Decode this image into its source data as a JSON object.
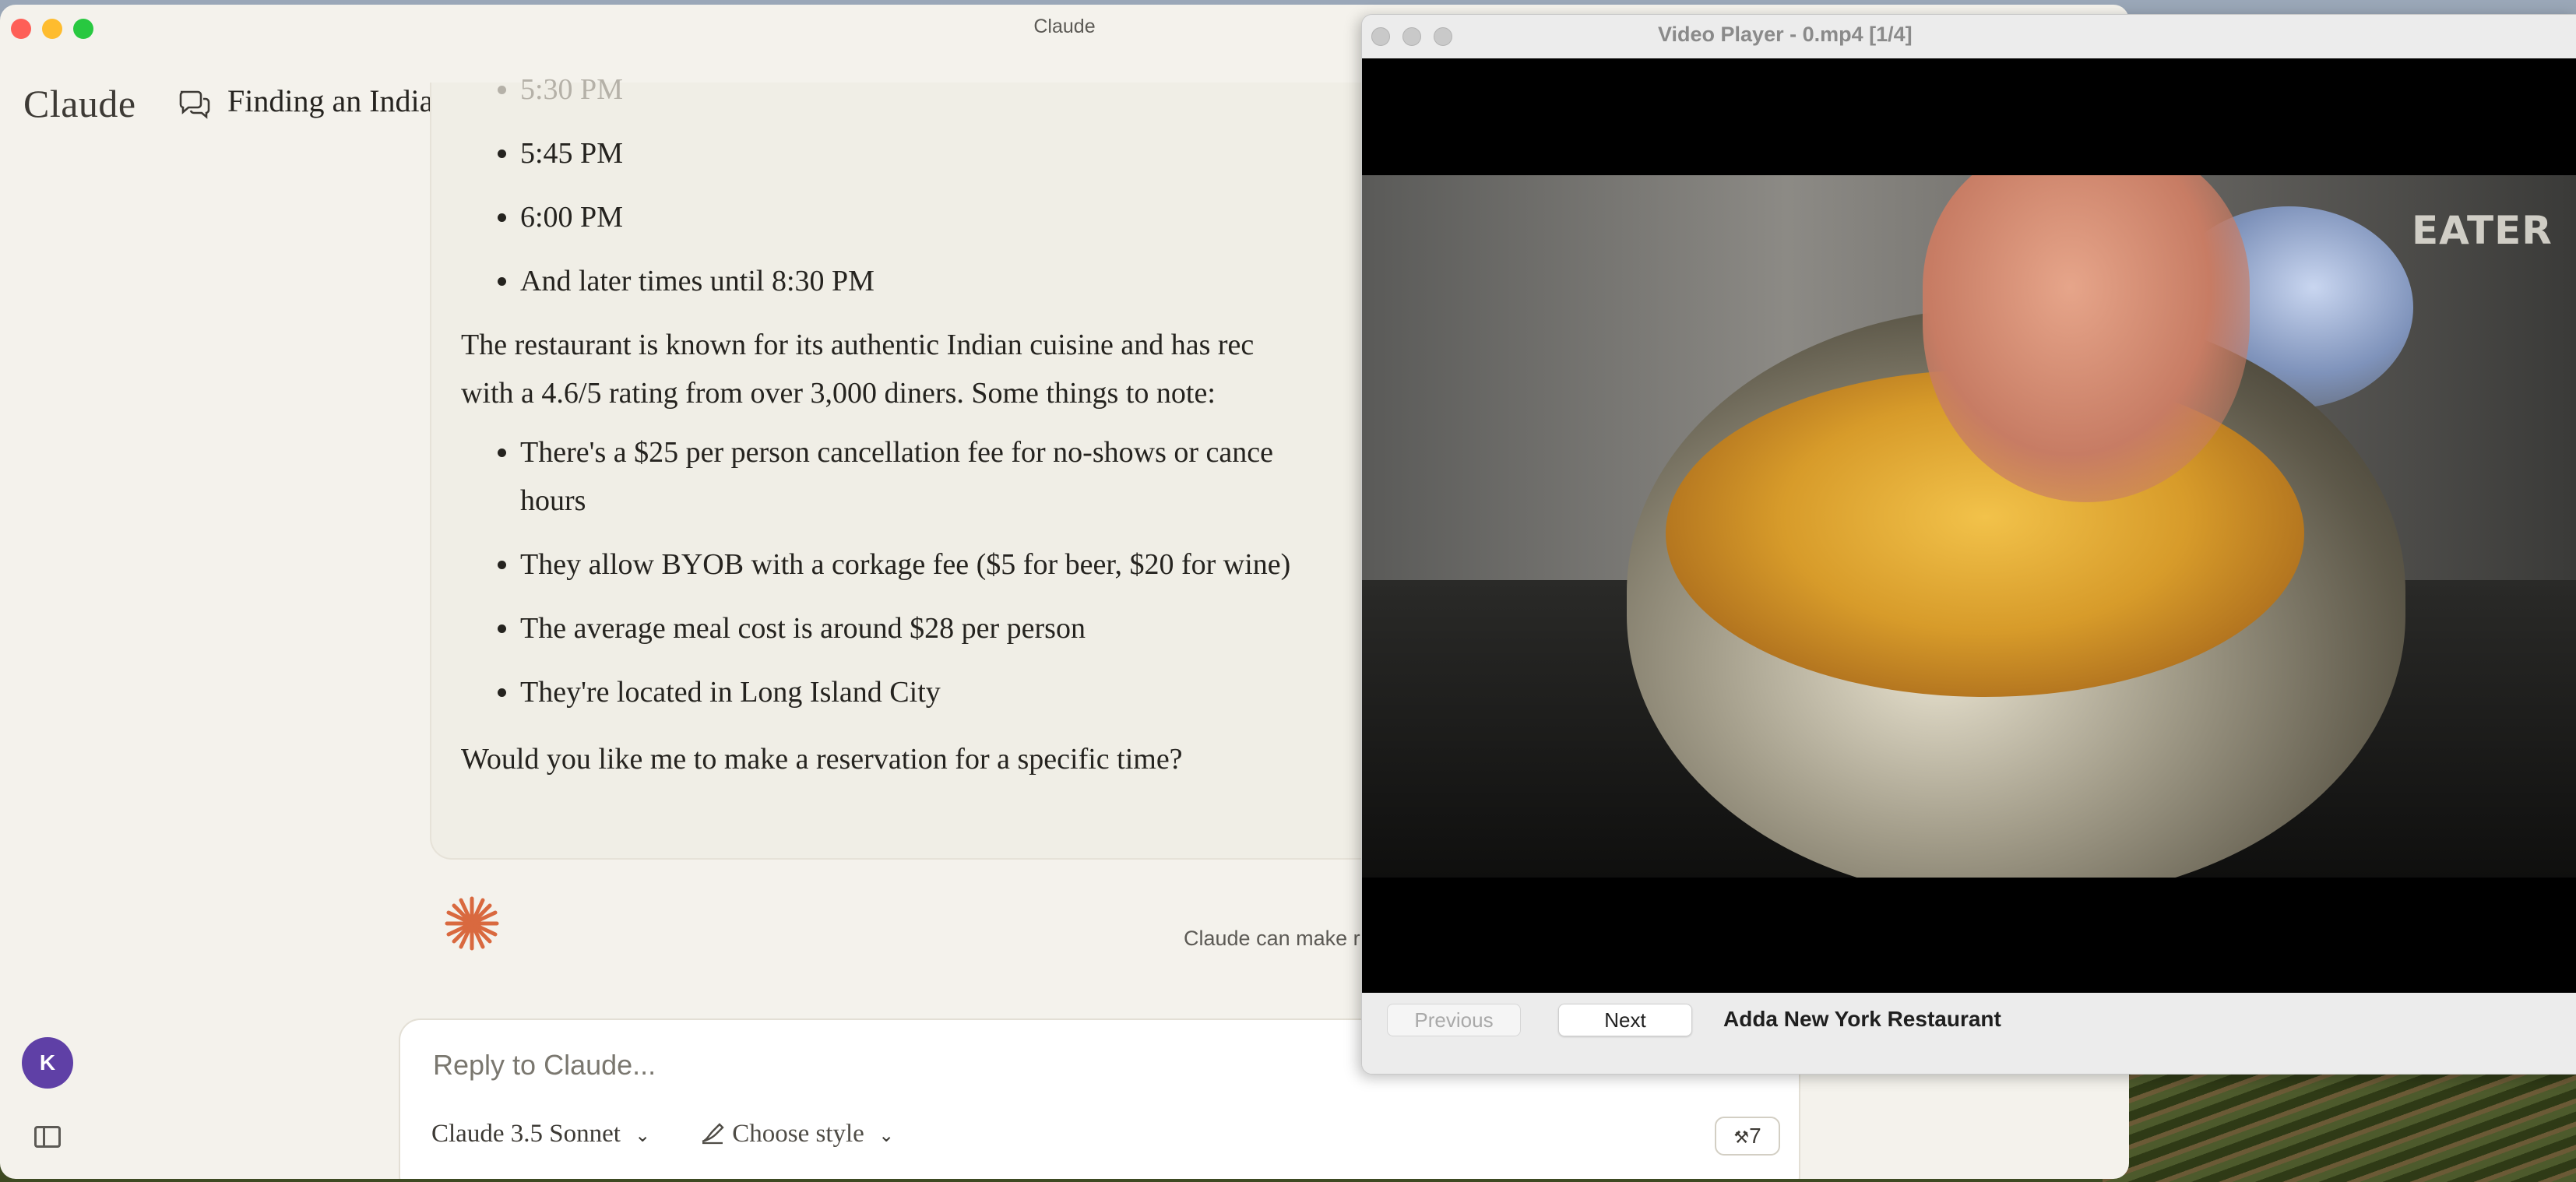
{
  "claude_window": {
    "title": "Claude",
    "app_name": "Claude",
    "chat_title": "Finding an Indian Restaurant for Two"
  },
  "message": {
    "time_slots": [
      "5:30 PM",
      "5:45 PM",
      "6:00 PM",
      "And later times until 8:30 PM"
    ],
    "paragraph": "The restaurant is known for its authentic Indian cuisine and has rec with a 4.6/5 rating from over 3,000 diners. Some things to note:",
    "paragraph_line1": "The restaurant is known for its authentic Indian cuisine and has rec",
    "paragraph_line2": "with a 4.6/5 rating from over 3,000 diners. Some things to note:",
    "notes": [
      "There's a $25 per person cancellation fee for no-shows or cance hours",
      "They allow BYOB with a corkage fee ($5 for beer, $20 for wine)",
      "The average meal cost is around $28 per person",
      "They're located in Long Island City"
    ],
    "note1_line1": "There's a $25 per person cancellation fee for no-shows or cance",
    "note1_line2": "hours",
    "closing_question": "Would you like me to make a reservation for a specific time?"
  },
  "disclaimer": "Claude can make r",
  "user": {
    "avatar_initial": "K"
  },
  "composer": {
    "placeholder": "Reply to Claude...",
    "model_brand": "Claude",
    "model_version": "3.5 Sonnet",
    "style_label": "Choose style",
    "tools_count": "7"
  },
  "video_player": {
    "title": "Video Player - 0.mp4 [1/4]",
    "watermark": "EATER",
    "previous_label": "Previous",
    "next_label": "Next",
    "caption": "Adda New York Restaurant"
  },
  "colors": {
    "claude_bg": "#f4f2ec",
    "accent_asterisk": "#d9693f",
    "avatar_bg": "#5f40a6"
  },
  "icons": [
    "chat-bubbles-icon",
    "chevron-down-icon",
    "claude-asterisk-icon",
    "sidebar-toggle-icon",
    "style-brush-icon",
    "tools-icon"
  ]
}
